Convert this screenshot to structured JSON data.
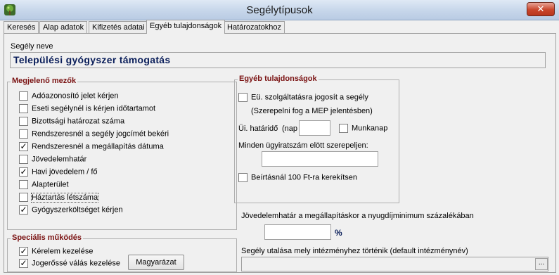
{
  "window": {
    "title": "Segélytípusok",
    "close_glyph": "✕",
    "app_icon": "app-tree-icon"
  },
  "tabs": [
    {
      "label": "Keresés",
      "active": false
    },
    {
      "label": "Alap adatok",
      "active": false
    },
    {
      "label": "Kifizetés adatai",
      "active": false
    },
    {
      "label": "Egyéb tulajdonságok",
      "active": true
    },
    {
      "label": "Határozatokhoz",
      "active": false
    }
  ],
  "segely_neve": {
    "label": "Segély neve",
    "value": "Települési gyógyszer támogatás"
  },
  "megjeleno_mezok": {
    "title": "Megjelenő mezők",
    "items": [
      {
        "label": "Adóazonosító jelet kérjen",
        "checked": false
      },
      {
        "label": "Eseti segélynél is kérjen időtartamot",
        "checked": false
      },
      {
        "label": "Bizottsági határozat száma",
        "checked": false
      },
      {
        "label": "Rendszeresnél a segély jogcímét bekéri",
        "checked": false
      },
      {
        "label": "Rendszeresnél a megállapítás dátuma",
        "checked": true
      },
      {
        "label": "Jövedelemhatár",
        "checked": false
      },
      {
        "label": "Havi jövedelem / fő",
        "checked": true
      },
      {
        "label": "Alapterület",
        "checked": false
      },
      {
        "label": "Háztartás létszáma",
        "checked": false
      },
      {
        "label": "Gyógyszerköltséget kérjen",
        "checked": true
      }
    ]
  },
  "specialis_mukodes": {
    "title": "Speciális működés",
    "items": [
      {
        "label": "Kérelem kezelése",
        "checked": true
      },
      {
        "label": "Jogerőssé válás kezelése",
        "checked": true
      }
    ],
    "explain_button": "Magyarázat"
  },
  "egyeb_tulajdonsagok": {
    "title": "Egyéb tulajdonságok",
    "eu_checkbox": {
      "label": "Eü. szolgáltatásra jogosít a segély",
      "checked": false
    },
    "eu_note": "(Szerepelni fog a MEP jelentésben)",
    "ui_hatarido_label": "Üi. határidő",
    "nap_label": "(nap",
    "nap_value": "",
    "munkanap": {
      "label": "Munkanap",
      "checked": false
    },
    "minden_label": "Minden ügyiratszám elött szerepeljen:",
    "minden_value": "",
    "beiratas": {
      "label": "Beírtásnál 100 Ft-ra kerekítsen",
      "checked": false
    }
  },
  "jovedelemhatar": {
    "label": "Jövedelemhatár a megállapításkor a nyugdíjminimum százalékában",
    "value": "",
    "unit": "%"
  },
  "intezmeny": {
    "label": "Segély utalása mely intézményhez történik (default intézménynév)",
    "value": "",
    "browse": "..."
  },
  "colors": {
    "group_title": "#7a1212",
    "name_text": "#0a1e5a",
    "close_button": "#c9462c"
  }
}
